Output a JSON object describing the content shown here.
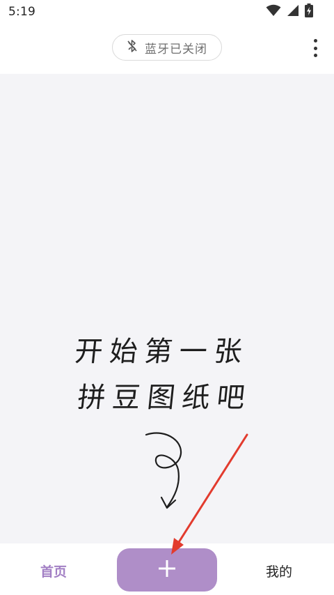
{
  "status_bar": {
    "time": "5:19",
    "icons": [
      "wifi-icon",
      "cell-signal-icon",
      "battery-charging-icon"
    ]
  },
  "header": {
    "bluetooth_status": "蓝牙已关闭",
    "bluetooth_icon": "bluetooth-off-icon",
    "menu_icon": "more-vert-icon"
  },
  "canvas": {
    "prompt_line1": "开始第一张",
    "prompt_line2": "拼豆图纸吧",
    "arrow_icon": "curly-arrow-down-icon"
  },
  "bottom_nav": {
    "home_label": "首页",
    "add_icon": "plus-icon",
    "mine_label": "我的"
  },
  "colors": {
    "accent": "#af8ec8",
    "active_tab": "#a27fc4",
    "canvas_bg": "#f4f4f7",
    "annotation_arrow": "#e23b2e"
  }
}
